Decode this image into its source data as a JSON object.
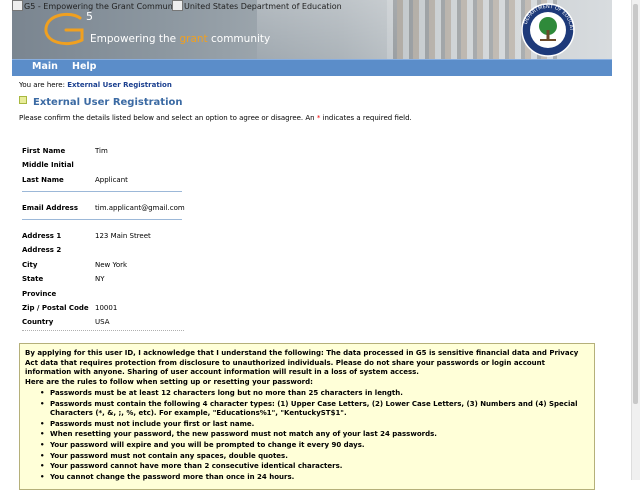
{
  "header": {
    "logo_alt": "G5 - Empowering the Grant Community",
    "seal_alt": "United States Department of Education",
    "tagline_pre": "Empowering the ",
    "tagline_hl": "grant",
    "tagline_post": " community",
    "seal_text": "DEPARTMENT OF EDUCATION"
  },
  "nav": {
    "main": "Main",
    "help": "Help"
  },
  "breadcrumb": {
    "prefix": "You are here: ",
    "current": "External User Registration"
  },
  "page_title": "External User Registration",
  "instructions": {
    "pre": "Please confirm the details listed below and select an option to agree or disagree. An ",
    "star": "*",
    "post": " indicates a required field."
  },
  "fields": {
    "first_name": {
      "label": "First Name",
      "value": "Tim"
    },
    "middle_initial": {
      "label": "Middle Initial",
      "value": ""
    },
    "last_name": {
      "label": "Last Name",
      "value": "Applicant"
    },
    "email": {
      "label": "Email Address",
      "value": "tim.applicant@gmail.com"
    },
    "address1": {
      "label": "Address 1",
      "value": "123 Main Street"
    },
    "address2": {
      "label": "Address 2",
      "value": ""
    },
    "city": {
      "label": "City",
      "value": "New York"
    },
    "state": {
      "label": "State",
      "value": "NY"
    },
    "province": {
      "label": "Province",
      "value": ""
    },
    "zip": {
      "label": "Zip / Postal Code",
      "value": "10001"
    },
    "country": {
      "label": "Country",
      "value": "USA"
    }
  },
  "terms": {
    "intro": "By applying for this user ID, I acknowledge that I understand the following: The data processed in G5 is sensitive financial data and Privacy Act data that requires protection from disclosure to unauthorized individuals. Please do not share your passwords or login account information with anyone. Sharing of user account information will result in a loss of system access.",
    "rules_heading": "Here are the rules to follow when setting up or resetting your password:",
    "rules": [
      "Passwords must be at least 12 characters long but no more than 25 characters in length.",
      "Passwords must contain the following 4 character types: (1) Upper Case Letters, (2) Lower Case Letters, (3) Numbers and (4) Special Characters (*, &, ;, %, etc). For example, \"Educations%1\", \"KentuckyST$1\".",
      "Passwords must not include your first or last name.",
      "When resetting your password, the new password must not match any of your last 24 passwords.",
      "Your password will expire and you will be prompted to change it every 90 days.",
      "Your password must not contain any spaces, double quotes.",
      "Your password cannot have more than 2 consecutive identical characters.",
      "You cannot change the password more than once in 24 hours."
    ]
  },
  "colors": {
    "nav_bar": "#5b8dc9",
    "title": "#3b6aa3",
    "link": "#1a3f8f",
    "terms_bg": "#ffffd8",
    "required": "#ee0000",
    "brand_orange": "#f0a020"
  }
}
